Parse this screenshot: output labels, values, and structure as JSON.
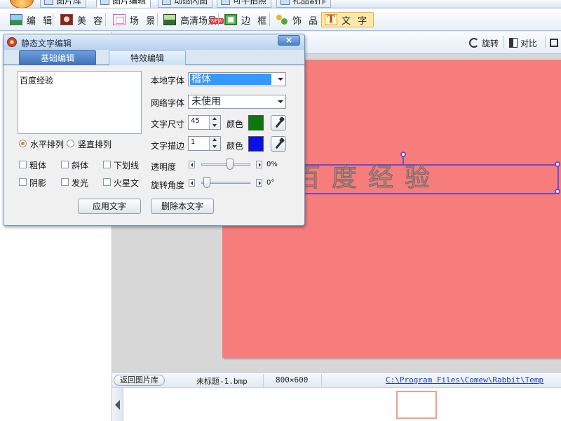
{
  "top_tabs": [
    {
      "label": "图片库"
    },
    {
      "label": "图片编辑"
    },
    {
      "label": "动感闪图"
    },
    {
      "label": "可牛拍照"
    },
    {
      "label": "礼品制作"
    }
  ],
  "toolbar": {
    "items": [
      {
        "label": "编 辑",
        "icon": "edit-icon"
      },
      {
        "label": "美 容",
        "icon": "beauty-icon"
      },
      {
        "label": "场 景",
        "icon": "scene-icon"
      },
      {
        "label": "高清场景",
        "icon": "hd-scene-icon"
      },
      {
        "label": "边 框",
        "icon": "frame-icon"
      },
      {
        "label": "饰 品",
        "icon": "decoration-icon"
      },
      {
        "label": "文 字",
        "icon": "text-icon",
        "selected": true
      }
    ],
    "new_badge": "NEW"
  },
  "editor_toolbar": {
    "rotate": "旋转",
    "compare": "对比"
  },
  "canvas": {
    "background": "#f77c7c",
    "text": "百度经验",
    "selection_color": "#6f4cc9"
  },
  "statusbar": {
    "back_button": "返回图片库",
    "filename": "未标题-1.bmp",
    "dimensions": "800×600",
    "path": "C:\\Program Files\\Comew\\Rabbit\\Temp"
  },
  "dialog": {
    "title": "静态文字编辑",
    "close_label": "×",
    "tabs": [
      {
        "label": "基础编辑",
        "active": true
      },
      {
        "label": "特效编辑",
        "active": false
      }
    ],
    "text_value": "百度经验",
    "layout": {
      "horizontal": "水平排列",
      "vertical": "竖直排列",
      "selected": "horizontal"
    },
    "styles": {
      "bold": "粗体",
      "italic": "斜体",
      "underline": "下划线",
      "shadow": "阴影",
      "glow": "发光",
      "sparkle": "火星文"
    },
    "local_font": {
      "label": "本地字体",
      "value": "楷体"
    },
    "web_font": {
      "label": "网络字体",
      "value": "未使用"
    },
    "size": {
      "label": "文字尺寸",
      "value": "45",
      "color_label": "颜色",
      "color": "#0a7a0a"
    },
    "stroke": {
      "label": "文字描边",
      "value": "1",
      "color_label": "颜色",
      "color": "#0b10e8"
    },
    "opacity": {
      "label": "透明度",
      "value": "0%",
      "fraction": 0.55
    },
    "rotation": {
      "label": "旋转角度",
      "value": "0°",
      "fraction": 0.0
    },
    "apply_button": "应用文字",
    "delete_button": "删除本文字"
  }
}
